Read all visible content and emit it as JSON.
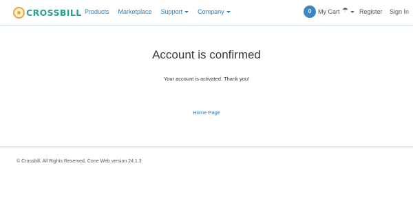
{
  "brand": {
    "logo_text": "CROSSBILL",
    "accent": "#2aa08c",
    "logo_color": "#f2a33a"
  },
  "nav": {
    "products": "Products",
    "marketplace": "Marketplace",
    "support": "Support",
    "company": "Company",
    "cart_count": "0",
    "cart_label": "My Cart",
    "umbrella_icon": "umbrella-icon",
    "register": "Register",
    "sign_in": "Sign In"
  },
  "main": {
    "title": "Account is confirmed",
    "message": "Your account is activated. Thank you!",
    "home_link": "Home Page"
  },
  "footer": {
    "text": "© Crossbill, All Rights Reserved, Cone Web version 24.1.3"
  }
}
